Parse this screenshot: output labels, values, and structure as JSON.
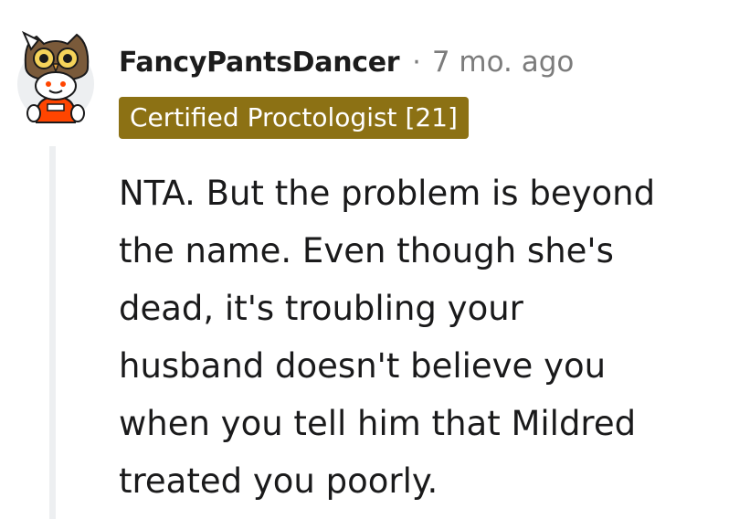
{
  "comment": {
    "author": "FancyPantsDancer",
    "separator": "·",
    "time_ago": "7 mo. ago",
    "flair": "Certified Proctologist [21]",
    "avatar_icon": "owl-hat-avatar-icon",
    "body_lines": [
      "NTA. But the problem is beyond",
      "the name. Even though she's",
      "dead, it's troubling your",
      "husband doesn't believe you",
      "when you tell him that Mildred",
      "treated you poorly."
    ]
  },
  "colors": {
    "flair_background": "#8c7114",
    "flair_text": "#ffffff",
    "meta_gray": "#7c7c7c",
    "thread_line": "#edeff1"
  }
}
